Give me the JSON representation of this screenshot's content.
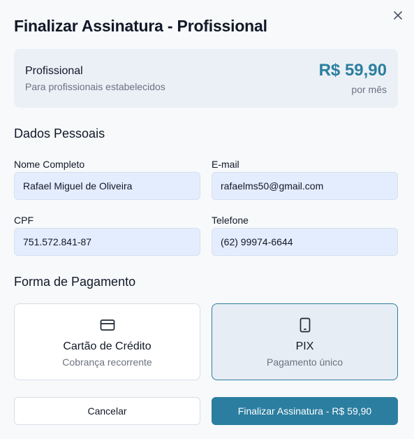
{
  "modal": {
    "title": "Finalizar Assinatura - Profissional",
    "close_icon": "close-icon"
  },
  "plan": {
    "name": "Profissional",
    "description": "Para profissionais estabelecidos",
    "price": "R$ 59,90",
    "period": "por mês"
  },
  "personal": {
    "section_title": "Dados Pessoais",
    "full_name": {
      "label": "Nome Completo",
      "value": "Rafael Miguel de Oliveira"
    },
    "email": {
      "label": "E-mail",
      "value": "rafaelms50@gmail.com"
    },
    "cpf": {
      "label": "CPF",
      "value": "751.572.841-87"
    },
    "phone": {
      "label": "Telefone",
      "value": "(62) 99974-6644"
    }
  },
  "payment": {
    "section_title": "Forma de Pagamento",
    "options": [
      {
        "title": "Cartão de Crédito",
        "subtitle": "Cobrança recorrente",
        "icon": "credit-card-icon",
        "selected": false
      },
      {
        "title": "PIX",
        "subtitle": "Pagamento único",
        "icon": "smartphone-icon",
        "selected": true
      }
    ]
  },
  "actions": {
    "cancel_label": "Cancelar",
    "submit_label": "Finalizar Assinatura - R$ 59,90"
  },
  "colors": {
    "accent": "#2c7ea0",
    "input_bg": "#e4edfd",
    "plan_card_bg": "#eaf0f6",
    "selected_option_bg": "#e6edf4"
  }
}
